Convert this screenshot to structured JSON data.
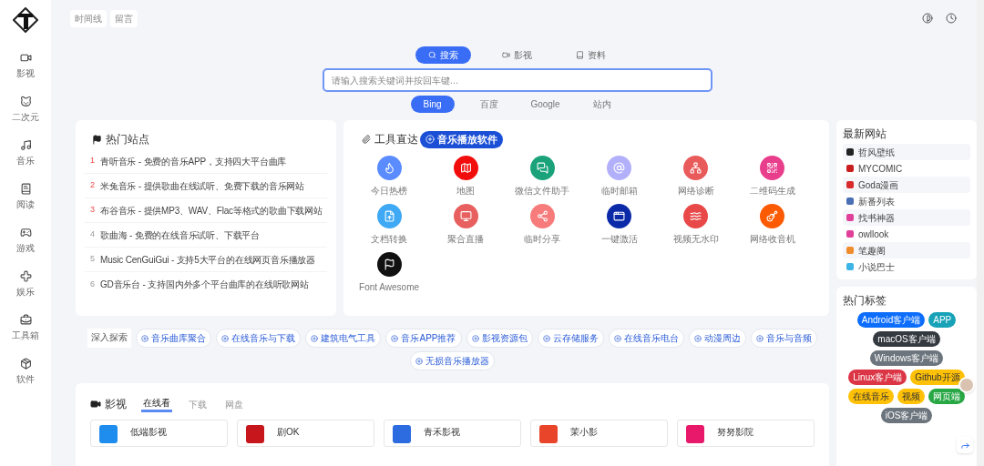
{
  "sidebar": {
    "items": [
      {
        "label": "影视"
      },
      {
        "label": "二次元"
      },
      {
        "label": "音乐"
      },
      {
        "label": "阅读"
      },
      {
        "label": "游戏"
      },
      {
        "label": "娱乐"
      },
      {
        "label": "工具箱"
      },
      {
        "label": "软件"
      }
    ]
  },
  "top_links": [
    "时间线",
    "留言"
  ],
  "search": {
    "categories": [
      {
        "label": "搜索",
        "selected": true
      },
      {
        "label": "影视",
        "selected": false
      },
      {
        "label": "资料",
        "selected": false
      }
    ],
    "placeholder": "请输入搜索关键词并按回车键…",
    "engines": [
      {
        "label": "Bing",
        "selected": true
      },
      {
        "label": "百度",
        "selected": false
      },
      {
        "label": "Google",
        "selected": false
      },
      {
        "label": "站内",
        "selected": false
      }
    ]
  },
  "hot_sites": {
    "title": "热门站点",
    "items": [
      {
        "rank": "1",
        "text": "青听音乐 - 免费的音乐APP，支持四大平台曲库",
        "top": true
      },
      {
        "rank": "2",
        "text": "米兔音乐 - 提供歌曲在线试听、免费下载的音乐网站",
        "top": true
      },
      {
        "rank": "3",
        "text": "布谷音乐 - 提供MP3、WAV、Flac等格式的歌曲下载网站",
        "top": true
      },
      {
        "rank": "4",
        "text": "歌曲海 - 免费的在线音乐试听、下载平台",
        "top": false
      },
      {
        "rank": "5",
        "text": "Music CenGuiGui - 支持5大平台的在线网页音乐播放器",
        "top": false
      },
      {
        "rank": "6",
        "text": "GD音乐台 - 支持国内外多个平台曲库的在线听歌网站",
        "top": false
      }
    ]
  },
  "tools": {
    "title": "工具直达",
    "badge": "音乐播放软件",
    "items": [
      {
        "label": "今日热榜",
        "color": "#5b8cff"
      },
      {
        "label": "地图",
        "color": "#f20d0d"
      },
      {
        "label": "微信文件助手",
        "color": "#1aa37a"
      },
      {
        "label": "临时邮箱",
        "color": "#b3b0fb"
      },
      {
        "label": "网络诊断",
        "color": "#e95b5b"
      },
      {
        "label": "二维码生成",
        "color": "#e83e8c"
      },
      {
        "label": "文档转换",
        "color": "#3fa9f5"
      },
      {
        "label": "聚合直播",
        "color": "#e85f5f"
      },
      {
        "label": "临时分享",
        "color": "#f77b7b"
      },
      {
        "label": "一键激活",
        "color": "#0b2aa8"
      },
      {
        "label": "视频无水印",
        "color": "#e84848"
      },
      {
        "label": "网络收音机",
        "color": "#fc5a03"
      },
      {
        "label": "Font Awesome",
        "color": "#111111"
      }
    ]
  },
  "new_sites": {
    "title": "最新网站",
    "items": [
      {
        "label": "哲风壁纸",
        "color": "#222222"
      },
      {
        "label": "MYCOMIC",
        "color": "#c81e1e"
      },
      {
        "label": "Goda漫画",
        "color": "#d92b2b"
      },
      {
        "label": "新番列表",
        "color": "#4a6fb5"
      },
      {
        "label": "找书神器",
        "color": "#e0409a"
      },
      {
        "label": "owllook",
        "color": "#e0409a"
      },
      {
        "label": "笔趣阁",
        "color": "#f08c2c"
      },
      {
        "label": "小说巴士",
        "color": "#3cb4e6"
      }
    ]
  },
  "hot_tags": {
    "title": "热门标签",
    "tags": [
      {
        "label": "Android客户端",
        "color": "#0d6efd"
      },
      {
        "label": "APP",
        "color": "#17a2b8"
      },
      {
        "label": "macOS客户端",
        "color": "#343a40"
      },
      {
        "label": "Windows客户端",
        "color": "#6c757d"
      },
      {
        "label": "Linux客户端",
        "color": "#dc3545"
      },
      {
        "label": "Github开源",
        "color": "#ffc107"
      },
      {
        "label": "在线音乐",
        "color": "#ffc107"
      },
      {
        "label": "视频",
        "color": "#ffc107"
      },
      {
        "label": "网页端",
        "color": "#28a745"
      },
      {
        "label": "iOS客户端",
        "color": "#6c757d"
      }
    ]
  },
  "explore": {
    "label": "深入探索",
    "tags": [
      "音乐曲库聚合",
      "在线音乐与下载",
      "建筑电气工具",
      "音乐APP推荐",
      "影视资源包",
      "云存储服务",
      "在线音乐电台",
      "动漫周边",
      "音乐与音频",
      "无损音乐播放器"
    ]
  },
  "movies": {
    "title": "影视",
    "tabs": [
      {
        "label": "在线看",
        "selected": true
      },
      {
        "label": "下载",
        "selected": false
      },
      {
        "label": "网盘",
        "selected": false
      }
    ],
    "cards": [
      {
        "name": "低端影视",
        "color": "#1f8ded"
      },
      {
        "name": "剧OK",
        "color": "#c8161d"
      },
      {
        "name": "青禾影视",
        "color": "#2d6be0"
      },
      {
        "name": "茉小影",
        "color": "#e8452a"
      },
      {
        "name": "努努影院",
        "color": "#e8186b"
      }
    ]
  }
}
